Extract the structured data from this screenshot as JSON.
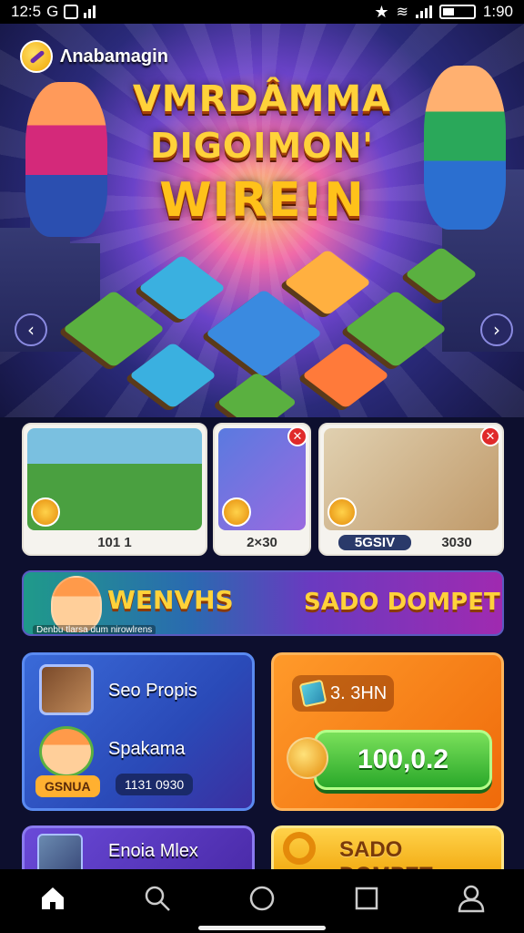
{
  "status_bar": {
    "time": "12:5",
    "carrier_letter": "G",
    "clock": "1:90"
  },
  "hero": {
    "brand_name": "Ʌnabamagin",
    "title_line1": "VMRDÂMMA",
    "title_line2": "DIGOIMON'",
    "title_line3": "WIRE!N",
    "accent_color": "#ffd23a"
  },
  "cards": [
    {
      "label": "101 1",
      "has_close": false
    },
    {
      "label": "2×30",
      "has_close": true
    },
    {
      "label_left": "5GSIV",
      "label_right": "3030",
      "has_close": true
    }
  ],
  "banner": {
    "title": "WENVHS",
    "right_text": "SADO DOMPET",
    "subtitle": "Denbu tlarsa dum nirowlrens"
  },
  "left_panel": {
    "row1_label": "Seo Propis",
    "row2_label": "Spakama",
    "badge": "GSNUA",
    "chip": "1131 0930"
  },
  "right_panel": {
    "ticket_value": "3. 3HN",
    "button_value": "100,0.2"
  },
  "bottom_panels": {
    "left_label": "Enoia Mlex",
    "right_label": "SADO DOMPET"
  },
  "nav": {
    "icons": [
      "home-icon",
      "search-icon",
      "circle-icon",
      "square-icon",
      "profile-icon"
    ]
  }
}
